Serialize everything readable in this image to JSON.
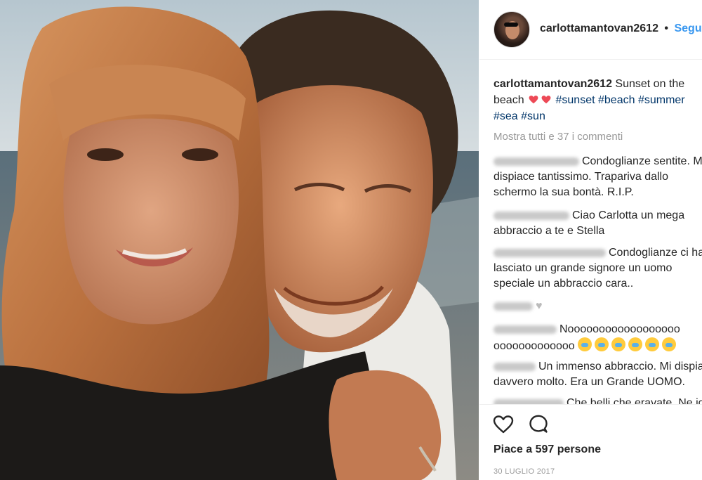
{
  "post": {
    "username": "carlottamantovan2612",
    "dot": "•",
    "follow_label": "Segui",
    "caption": {
      "text_a": "Sunset on the",
      "text_b": "beach",
      "tags_line2": [
        "#sunset",
        "#beach",
        "#summer"
      ],
      "tags_line3": [
        "#sea",
        "#sun"
      ]
    },
    "view_all_comments": "Mostra tutti e 37 i commenti",
    "comments": [
      {
        "lines": [
          "Condoglianze sentite. Mi",
          "dispiace tantissimo. Trapariva dallo",
          "schermo la sua bontà. R.I.P."
        ]
      },
      {
        "lines": [
          "Ciao Carlotta un mega",
          "abbraccio a te e Stella"
        ]
      },
      {
        "lines": [
          "Condoglianze ci ha",
          "lasciato un grande signore un uomo",
          "speciale un abbraccio cara.."
        ]
      },
      {
        "lines": [
          "♥"
        ]
      },
      {
        "lines": [
          "Noooooooooooooooooo",
          "ooooooooooooo"
        ]
      },
      {
        "lines": [
          "Un immenso abbraccio. Mi dispiace",
          "davvero molto. Era un Grande UOMO."
        ]
      },
      {
        "lines": [
          "Che belli che eravate. Ne io"
        ]
      }
    ],
    "likes_text": "Piace a 597 persone",
    "date": "30 LUGLIO 2017"
  },
  "icons": {
    "like": "heart-outline-icon",
    "comment": "speech-bubble-icon",
    "caption_hearts": "red-heart-icon",
    "crying_emoji": "loudly-crying-face-icon"
  },
  "colors": {
    "link_blue": "#3897f0",
    "hashtag": "#003569",
    "meta_grey": "#999999",
    "heart_red": "#ed4956"
  }
}
